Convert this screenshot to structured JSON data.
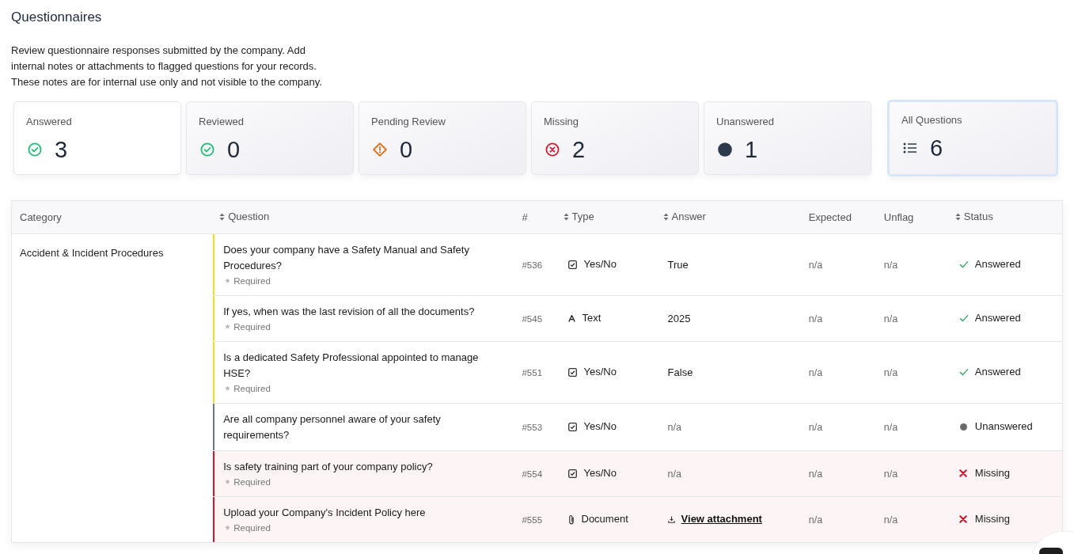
{
  "page": {
    "title": "Questionnaires",
    "description": "Review questionnaire responses submitted by the company. Add internal notes or attachments to flagged questions for your records. These notes are for internal use only and not visible to the company."
  },
  "stats": [
    {
      "kind": "answered",
      "label": "Answered",
      "count": "3",
      "selected": false,
      "hovered": true
    },
    {
      "kind": "reviewed",
      "label": "Reviewed",
      "count": "0",
      "selected": false,
      "hovered": false
    },
    {
      "kind": "pending",
      "label": "Pending Review",
      "count": "0",
      "selected": false,
      "hovered": false
    },
    {
      "kind": "missing",
      "label": "Missing",
      "count": "2",
      "selected": false,
      "hovered": false
    },
    {
      "kind": "unanswered",
      "label": "Unanswered",
      "count": "1",
      "selected": false,
      "hovered": false
    },
    {
      "kind": "all",
      "label": "All Questions",
      "count": "6",
      "selected": true,
      "hovered": false
    }
  ],
  "table": {
    "columns": [
      {
        "label": "Category",
        "sortable": false
      },
      {
        "label": "Question",
        "sortable": true
      },
      {
        "label": "#",
        "sortable": false
      },
      {
        "label": "Type",
        "sortable": true
      },
      {
        "label": "Answer",
        "sortable": true
      },
      {
        "label": "Expected",
        "sortable": false
      },
      {
        "label": "Unflag",
        "sortable": false
      },
      {
        "label": "Status",
        "sortable": true
      }
    ],
    "groups": [
      {
        "category": "Accident & Incident Procedures",
        "rows": [
          {
            "color": "#f5df1e",
            "question": "Does your company have a Safety Manual and Safety Procedures?",
            "required_note": "Required",
            "number": "#536",
            "type": {
              "kind": "yesno",
              "label": "Yes/No"
            },
            "answer": {
              "kind": "value",
              "text": "True"
            },
            "expected": "n/a",
            "unflag": "n/a",
            "status": {
              "kind": "answered",
              "label": "Answered"
            }
          },
          {
            "color": "#f5df1e",
            "question": "If yes, when was the last revision of all the documents?",
            "required_note": "Required",
            "number": "#545",
            "type": {
              "kind": "text",
              "label": "Text"
            },
            "answer": {
              "kind": "value",
              "text": "2025"
            },
            "expected": "n/a",
            "unflag": "n/a",
            "status": {
              "kind": "answered",
              "label": "Answered"
            }
          },
          {
            "color": "#f5df1e",
            "question": "Is a dedicated Safety Professional appointed to manage HSE?",
            "required_note": "Required",
            "number": "#551",
            "type": {
              "kind": "yesno",
              "label": "Yes/No"
            },
            "answer": {
              "kind": "value",
              "text": "False"
            },
            "expected": "n/a",
            "unflag": "n/a",
            "status": {
              "kind": "answered",
              "label": "Answered"
            }
          },
          {
            "color": "#6b7280",
            "question": "Are all company personnel aware of your safety requirements?",
            "number": "#553",
            "type": {
              "kind": "yesno",
              "label": "Yes/No"
            },
            "answer": {
              "kind": "none",
              "text": "n/a"
            },
            "expected": "n/a",
            "unflag": "n/a",
            "status": {
              "kind": "unanswered",
              "label": "Unanswered"
            }
          },
          {
            "color": "#d9142a",
            "question": "Is safety training part of your company policy?",
            "required_note": "Required",
            "number": "#554",
            "type": {
              "kind": "yesno",
              "label": "Yes/No"
            },
            "answer": {
              "kind": "none",
              "text": "n/a"
            },
            "expected": "n/a",
            "unflag": "n/a",
            "status": {
              "kind": "missing",
              "label": "Missing"
            }
          },
          {
            "color": "#d9142a",
            "question": "Upload your Company's Incident Policy here",
            "required_note": "Required",
            "number": "#555",
            "type": {
              "kind": "document",
              "label": "Document"
            },
            "answer": {
              "kind": "link",
              "text": "View attachment"
            },
            "expected": "n/a",
            "unflag": "n/a",
            "status": {
              "kind": "missing",
              "label": "Missing"
            }
          }
        ]
      }
    ]
  }
}
